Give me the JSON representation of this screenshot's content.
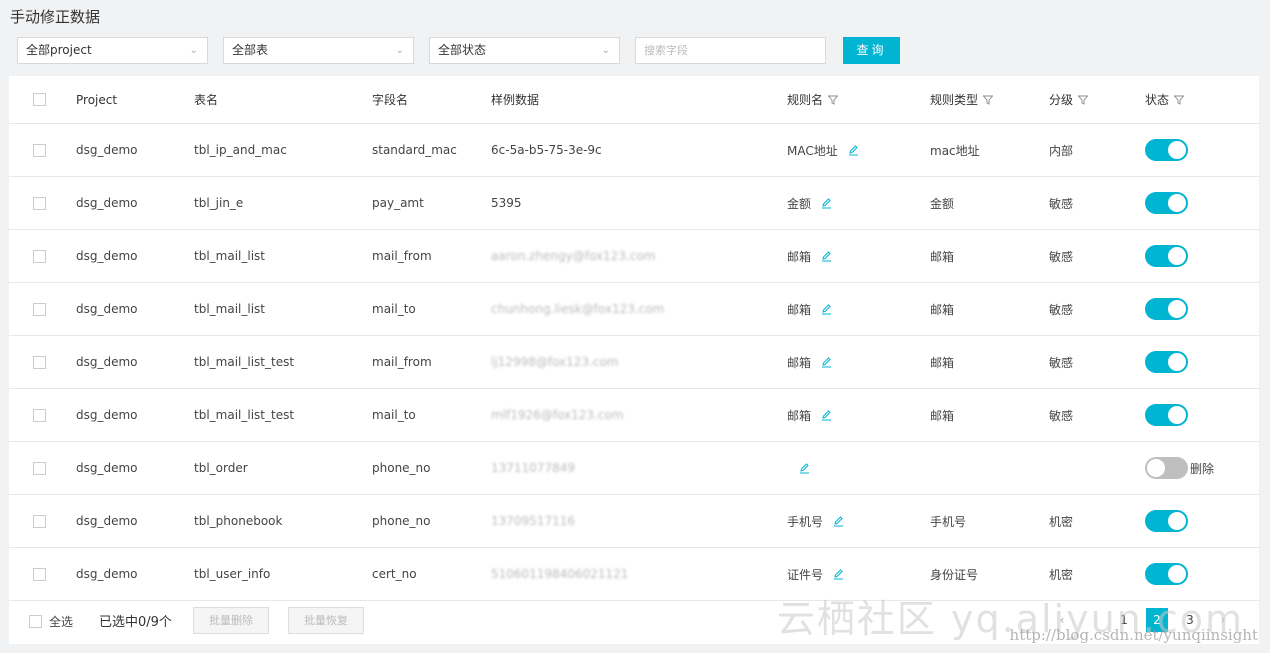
{
  "page_title": "手动修正数据",
  "filters": {
    "project": "全部project",
    "table": "全部表",
    "status": "全部状态",
    "search_placeholder": "搜索字段",
    "query_label": "查询"
  },
  "headers": {
    "project": "Project",
    "table": "表名",
    "field": "字段名",
    "sample": "样例数据",
    "rule_name": "规则名",
    "rule_type": "规则类型",
    "level": "分级",
    "status": "状态"
  },
  "rows": [
    {
      "project": "dsg_demo",
      "table": "tbl_ip_and_mac",
      "field": "standard_mac",
      "sample": "6c-5a-b5-75-3e-9c",
      "rule_name": "MAC地址",
      "rule_type": "mac地址",
      "level": "内部",
      "enabled": true,
      "note": ""
    },
    {
      "project": "dsg_demo",
      "table": "tbl_jin_e",
      "field": "pay_amt",
      "sample": "5395",
      "rule_name": "金额",
      "rule_type": "金额",
      "level": "敏感",
      "enabled": true,
      "note": ""
    },
    {
      "project": "dsg_demo",
      "table": "tbl_mail_list",
      "field": "mail_from",
      "sample": "aaron.zhengy@fox123.com",
      "rule_name": "邮箱",
      "rule_type": "邮箱",
      "level": "敏感",
      "enabled": true,
      "note": ""
    },
    {
      "project": "dsg_demo",
      "table": "tbl_mail_list",
      "field": "mail_to",
      "sample": "chunhong.liesk@fox123.com",
      "rule_name": "邮箱",
      "rule_type": "邮箱",
      "level": "敏感",
      "enabled": true,
      "note": ""
    },
    {
      "project": "dsg_demo",
      "table": "tbl_mail_list_test",
      "field": "mail_from",
      "sample": "lj12998@fox123.com",
      "rule_name": "邮箱",
      "rule_type": "邮箱",
      "level": "敏感",
      "enabled": true,
      "note": ""
    },
    {
      "project": "dsg_demo",
      "table": "tbl_mail_list_test",
      "field": "mail_to",
      "sample": "mlf1926@fox123.com",
      "rule_name": "邮箱",
      "rule_type": "邮箱",
      "level": "敏感",
      "enabled": true,
      "note": ""
    },
    {
      "project": "dsg_demo",
      "table": "tbl_order",
      "field": "phone_no",
      "sample": "13711077849",
      "rule_name": "",
      "rule_type": "",
      "level": "",
      "enabled": false,
      "note": "删除"
    },
    {
      "project": "dsg_demo",
      "table": "tbl_phonebook",
      "field": "phone_no",
      "sample": "13709517116",
      "rule_name": "手机号",
      "rule_type": "手机号",
      "level": "机密",
      "enabled": true,
      "note": ""
    },
    {
      "project": "dsg_demo",
      "table": "tbl_user_info",
      "field": "cert_no",
      "sample": "510601198406021121",
      "rule_name": "证件号",
      "rule_type": "身份证号",
      "level": "机密",
      "enabled": true,
      "note": ""
    }
  ],
  "footer": {
    "select_all": "全选",
    "selected_count": "已选中0/9个",
    "batch_delete": "批量删除",
    "batch_restore": "批量恢复"
  },
  "pagination": {
    "prev": "‹",
    "pages": [
      "1",
      "2",
      "3"
    ],
    "current": "2",
    "next": "›"
  },
  "watermark": {
    "brand": "云栖社区 yq.aliyun.com",
    "url": "http://blog.csdn.net/yunqiinsight"
  },
  "colors": {
    "accent": "#00b4d2",
    "toggle_off": "#bfbfbf"
  }
}
